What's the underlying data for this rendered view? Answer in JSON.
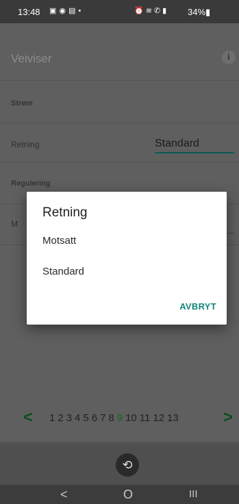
{
  "status_bar": {
    "time": "13:48",
    "left_icons": [
      "image-icon",
      "location-icon",
      "sim-icon",
      "dot-icon"
    ],
    "right_icons": [
      "alarm-icon",
      "wifi-icon",
      "call-icon",
      "signal-icon"
    ],
    "battery": "34%"
  },
  "app": {
    "title": "Veiviser",
    "info_icon_text": "i"
  },
  "form": {
    "section_strom": "Strøm",
    "retning_label": "Retning",
    "retning_value": "Standard",
    "section_regulering": "Regulering",
    "hidden_label_initial": "M"
  },
  "dialog": {
    "title": "Retning",
    "options": [
      "Motsatt",
      "Standard"
    ],
    "cancel": "AVBRYT"
  },
  "pager": {
    "prev": "<",
    "next": ">",
    "pages": [
      "1",
      "2",
      "3",
      "4",
      "5",
      "6",
      "7",
      "8",
      "9",
      "10",
      "11",
      "12",
      "13"
    ],
    "current_index": 8
  },
  "nav": {
    "back_action_icon": "undo-icon",
    "recent": "<",
    "home": "O",
    "menu": "III"
  },
  "colors": {
    "accent_green": "#14857a",
    "page_current": "#0c6b1a",
    "arrow_green": "#0a4f20"
  }
}
